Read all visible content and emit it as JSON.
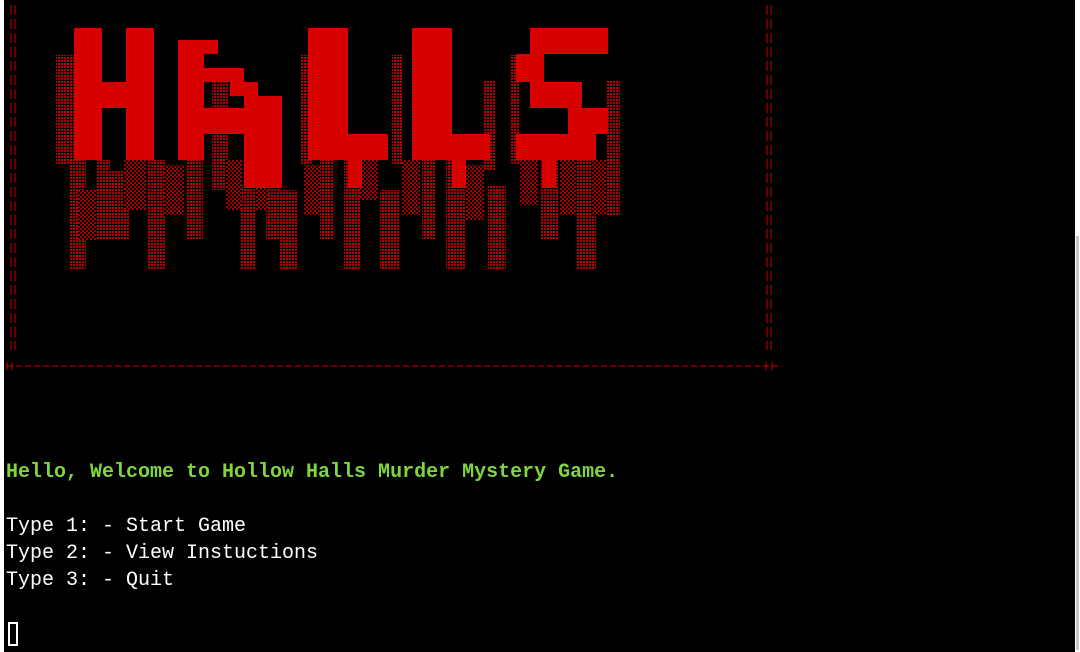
{
  "terminal": {
    "banner": {
      "title_art": "HALLS",
      "frame_color": "#cc0000",
      "art_color": "#d60000",
      "shade_color": "#8a0000"
    },
    "welcome_message": "Hello, Welcome to Hollow Halls Murder Mystery Game.",
    "menu": [
      {
        "label": "Type 1: - Start Game"
      },
      {
        "label": "Type 2: - View Instuctions"
      },
      {
        "label": "Type 3: - Quit"
      }
    ],
    "colors": {
      "background": "#000000",
      "text": "#ffffff",
      "welcome": "#7fd63a"
    }
  }
}
